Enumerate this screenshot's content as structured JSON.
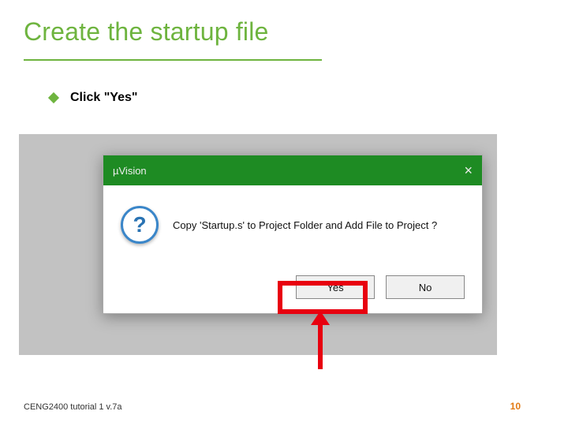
{
  "slide": {
    "title": "Create the startup file",
    "bullet_text": "Click \"Yes\""
  },
  "dialog": {
    "window_title": "µVision",
    "close_label": "×",
    "icon_name": "question-icon",
    "question_mark": "?",
    "message": "Copy 'Startup.s' to Project Folder and Add File to Project ?",
    "yes_label": "Yes",
    "no_label": "No"
  },
  "footer": {
    "left": "CENG2400 tutorial 1 v.7a",
    "page_number": "10"
  },
  "colors": {
    "accent_green": "#6eb43f",
    "titlebar_green": "#1e8b23",
    "highlight_red": "#e8000f",
    "page_num_orange": "#e27a13"
  }
}
